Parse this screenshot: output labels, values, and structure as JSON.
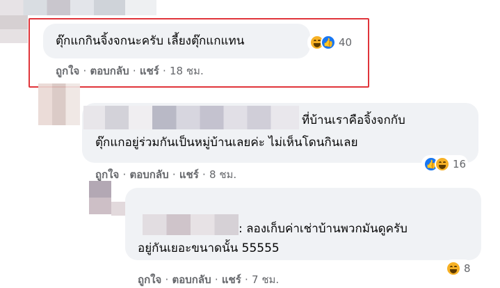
{
  "comments": [
    {
      "text_lines": [
        "ตุ๊กแกกินจิ้งจกนะครับ เลี้ยงตุ๊กแกแทน"
      ],
      "reactions": [
        "haha",
        "like"
      ],
      "reaction_count": "40",
      "actions": {
        "like": "ถูกใจ",
        "reply": "ตอบกลับ",
        "share": "แชร์",
        "time": "18 ชม."
      }
    },
    {
      "text_lines": [
        "ที่บ้านเราคือจิ้งจกกับ",
        "ตุ๊กแกอยู่ร่วมกันเป็นหมู่บ้านเลยค่ะ ไม่เห็นโดนกินเลย"
      ],
      "reactions": [
        "like",
        "haha"
      ],
      "reaction_count": "16",
      "actions": {
        "like": "ถูกใจ",
        "reply": "ตอบกลับ",
        "share": "แชร์",
        "time": "8 ชม."
      }
    },
    {
      "text_lines": [
        ": ลองเก็บค่าเช่าบ้านพวกมันดูครับ",
        "อยู่กันเยอะขนาดนั้น 55555"
      ],
      "reactions": [
        "haha"
      ],
      "reaction_count": "8",
      "actions": {
        "like": "ถูกใจ",
        "reply": "ตอบกลับ",
        "share": "แชร์",
        "time": "7 ชม."
      }
    }
  ],
  "separator": "·",
  "colors": {
    "bubble": "#f0f2f5",
    "meta": "#65676b",
    "highlight": "#e0343a",
    "like": "#1877f2",
    "haha": "#f7b125"
  }
}
